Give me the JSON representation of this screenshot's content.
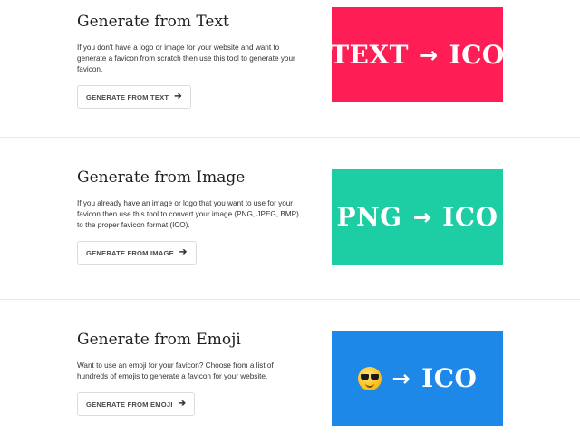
{
  "sections": [
    {
      "title": "Generate from Text",
      "description": "If you don't have a logo or image for your website and want to generate a favicon from scratch then use this tool to generate your favicon.",
      "button_label": "GENERATE FROM TEXT",
      "banner": {
        "left": "TEXT",
        "arrow": "→",
        "right": "ICO",
        "color": "#ff1d55"
      }
    },
    {
      "title": "Generate from Image",
      "description": "If you already have an image or logo that you want to use for your favicon then use this tool to convert your image (PNG, JPEG, BMP) to the proper favicon format (ICO).",
      "button_label": "GENERATE FROM IMAGE",
      "banner": {
        "left": "PNG",
        "arrow": "→",
        "right": "ICO",
        "color": "#1dcda4"
      }
    },
    {
      "title": "Generate from Emoji",
      "description": "Want to use an emoji for your favicon? Choose from a list of hundreds of emojis to generate a favicon for your website.",
      "button_label": "GENERATE FROM EMOJI",
      "banner": {
        "left_icon": "sunglasses-emoji-icon",
        "arrow": "→",
        "right": "ICO",
        "color": "#1e88e8"
      }
    }
  ],
  "button_arrow_icon": "arrow-right-icon"
}
